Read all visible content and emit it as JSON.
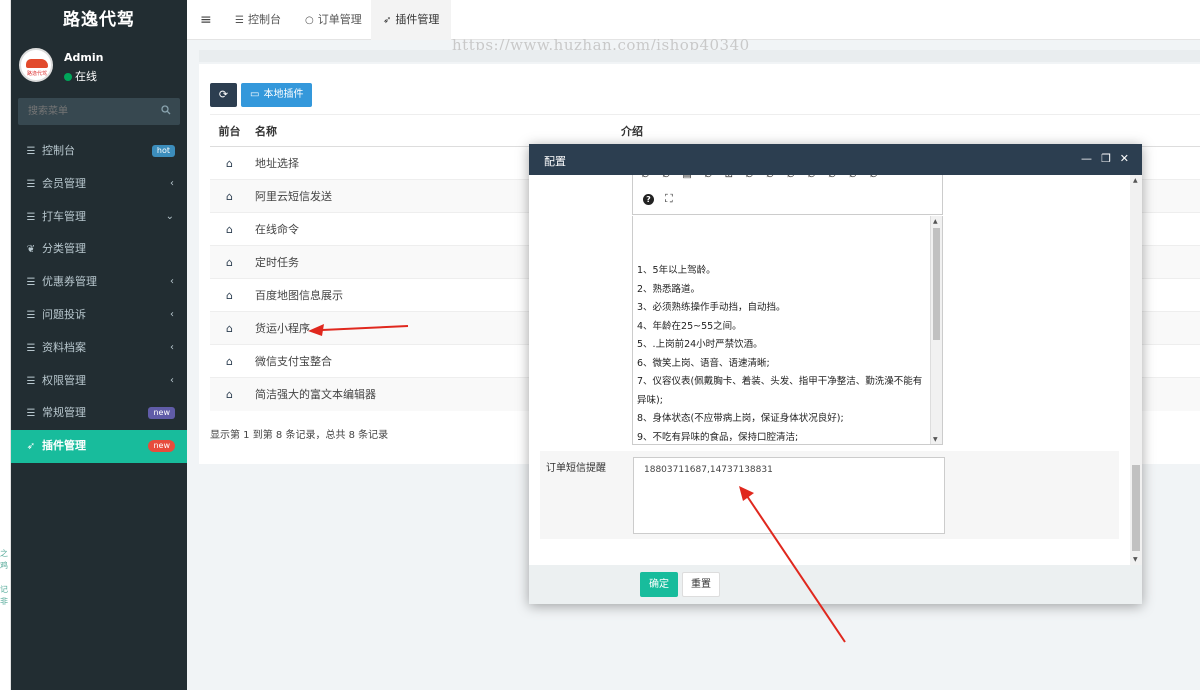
{
  "app": {
    "brand": "路逸代驾"
  },
  "user": {
    "name": "Admin",
    "status": "在线",
    "avatar_text": "路逸代驾"
  },
  "search": {
    "placeholder": "搜索菜单"
  },
  "menu": [
    {
      "label": "控制台",
      "icon": "list-icon",
      "badge": "hot",
      "badge_color": "#3c8dbc"
    },
    {
      "label": "会员管理",
      "icon": "list-icon",
      "chevron": "‹"
    },
    {
      "label": "打车管理",
      "icon": "list-icon",
      "chevron": "⌄"
    },
    {
      "label": "分类管理",
      "icon": "leaf-icon"
    },
    {
      "label": "优惠券管理",
      "icon": "list-icon",
      "chevron": "‹"
    },
    {
      "label": "问题投诉",
      "icon": "list-icon",
      "chevron": "‹"
    },
    {
      "label": "资料档案",
      "icon": "list-icon",
      "chevron": "‹"
    },
    {
      "label": "权限管理",
      "icon": "list-icon",
      "chevron": "‹"
    },
    {
      "label": "常规管理",
      "icon": "list-icon",
      "badge": "new",
      "badge_color": "#605ca8"
    },
    {
      "label": "插件管理",
      "icon": "rocket-icon",
      "badge": "new",
      "badge_color": "#e74c3c",
      "active": true
    }
  ],
  "tabs": [
    {
      "label": "控制台",
      "icon": "list-icon"
    },
    {
      "label": "订单管理",
      "icon": "circle-icon"
    },
    {
      "label": "插件管理",
      "icon": "rocket-icon",
      "active": true
    }
  ],
  "watermark": "https://www.huzhan.com/ishop40340",
  "toolbar": {
    "local_plugins_label": "本地插件"
  },
  "table": {
    "headers": [
      "前台",
      "名称",
      "介绍"
    ],
    "rows": [
      {
        "name": "地址选择"
      },
      {
        "name": "阿里云短信发送"
      },
      {
        "name": "在线命令"
      },
      {
        "name": "定时任务"
      },
      {
        "name": "百度地图信息展示"
      },
      {
        "name": "货运小程序"
      },
      {
        "name": "微信支付宝整合"
      },
      {
        "name": "简洁强大的富文本编辑器"
      }
    ],
    "pager_text": "显示第 1 到第 8 条记录，总共 8 条记录"
  },
  "modal": {
    "title": "配置",
    "editor_lines": [
      "1、5年以上驾龄。",
      "2、熟悉路道。",
      "3、必须熟练操作手动挡，自动挡。",
      "4、年龄在25~55之间。",
      "5、.上岗前24小时严禁饮酒。",
      "6、微笑上岗、语音、语速清晰;",
      "7、仪容仪表(佩戴胸卡、着装、头发、指甲干净整洁、勤洗澡不能有异味);",
      "8、身体状态(不应带病上岗，保证身体状况良好);",
      "9、不吃有异味的食品，保持口腔清洁;"
    ],
    "sms_label": "订单短信提醒",
    "sms_value": "18803711687,14737138831",
    "ok_label": "确定",
    "reset_label": "重置"
  },
  "colors": {
    "sidebar_bg": "#222d32",
    "accent": "#18bc9c",
    "header_dark": "#2c3e50",
    "primary_btn": "#3498db",
    "arrow": "#e0281e"
  }
}
